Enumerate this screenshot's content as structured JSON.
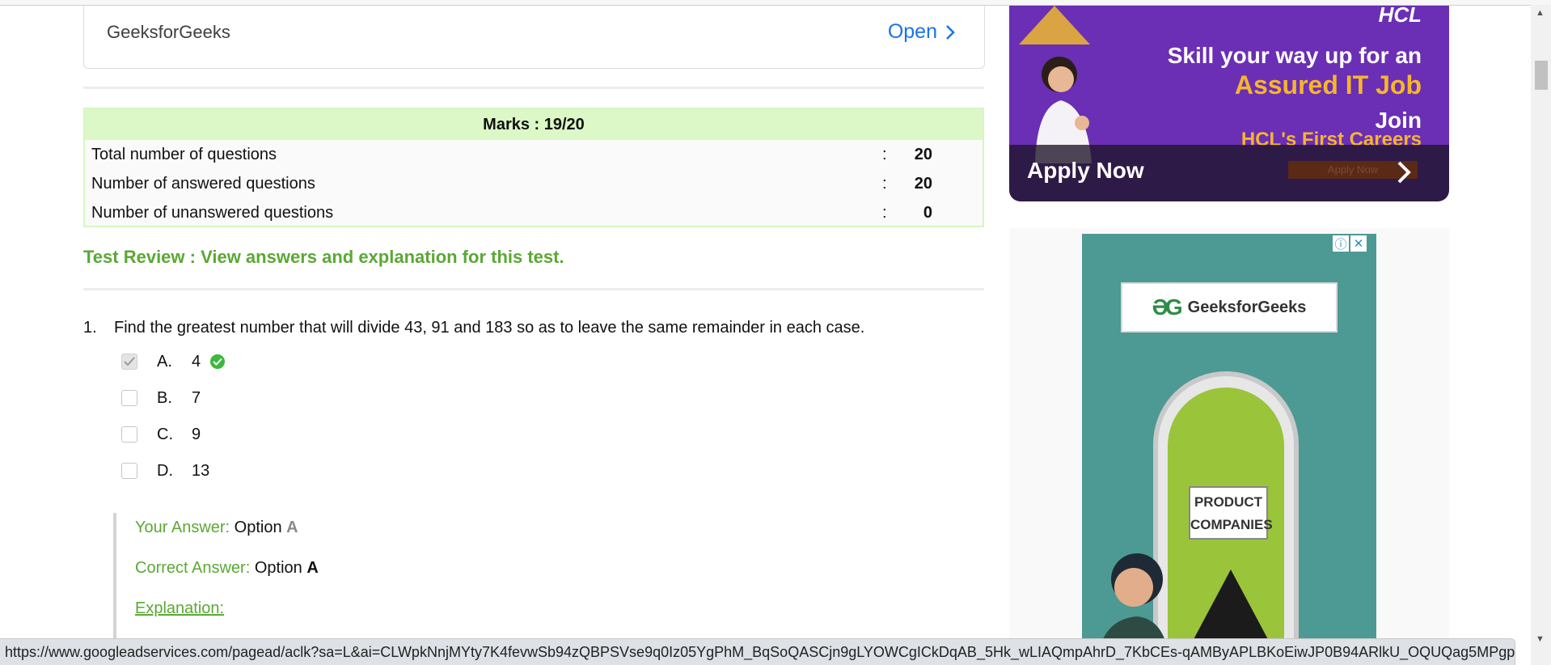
{
  "top_ad": {
    "brand": "GeeksforGeeks",
    "open_label": "Open"
  },
  "marks": {
    "header": "Marks : 19/20",
    "rows": [
      {
        "label": "Total number of questions",
        "colon": ":",
        "value": "20"
      },
      {
        "label": "Number of answered questions",
        "colon": ":",
        "value": "20"
      },
      {
        "label": "Number of unanswered questions",
        "colon": ":",
        "value": "0"
      }
    ]
  },
  "review_link": "Test Review : View answers and explanation for this test.",
  "question": {
    "number": "1.",
    "text": "Find the greatest number that will divide 43, 91 and 183 so as to leave the same remainder in each case.",
    "options": [
      {
        "letter": "A.",
        "value": "4",
        "checked": true,
        "correct": true
      },
      {
        "letter": "B.",
        "value": "7",
        "checked": false,
        "correct": false
      },
      {
        "letter": "C.",
        "value": "9",
        "checked": false,
        "correct": false
      },
      {
        "letter": "D.",
        "value": "13",
        "checked": false,
        "correct": false
      }
    ],
    "your_answer_label": "Your Answer:",
    "your_answer_prefix": "Option",
    "your_answer_value": "A",
    "correct_answer_label": "Correct Answer:",
    "correct_answer_prefix": "Option",
    "correct_answer_value": "A",
    "explanation_link": "Explanation:"
  },
  "hcl_ad": {
    "brand": "HCL",
    "line1": "Skill your way up for an",
    "line2": "Assured IT Job",
    "line3": "Join",
    "line4": "HCL's First Careers",
    "cta": "Apply Now",
    "mini_cta": "Apply Now"
  },
  "gfg_ad": {
    "info_glyph": "ⓘ",
    "close_glyph": "✕",
    "logo_mark": "ƏG",
    "logo_text": "GeeksforGeeks",
    "sign_line1": "PRODUCT",
    "sign_line2": "COMPANIES"
  },
  "status_url": "https://www.googleadservices.com/pagead/aclk?sa=L&ai=CLWpkNnjMYty7K4fevwSb94zQBPSVse9q0Iz05YgPhM_BqSoQASCjn9gLYOWCgICkDqAB_5Hk_wLIAQmpAhrD_7KbCEs-qAMByAPLBKoEiwJP0B94ARlkU_OQUQag5MPgpZa3Oz...",
  "colors": {
    "accent_green": "#5ba834",
    "link_blue": "#1a73e8",
    "marks_header_bg": "#dcf8c6"
  }
}
